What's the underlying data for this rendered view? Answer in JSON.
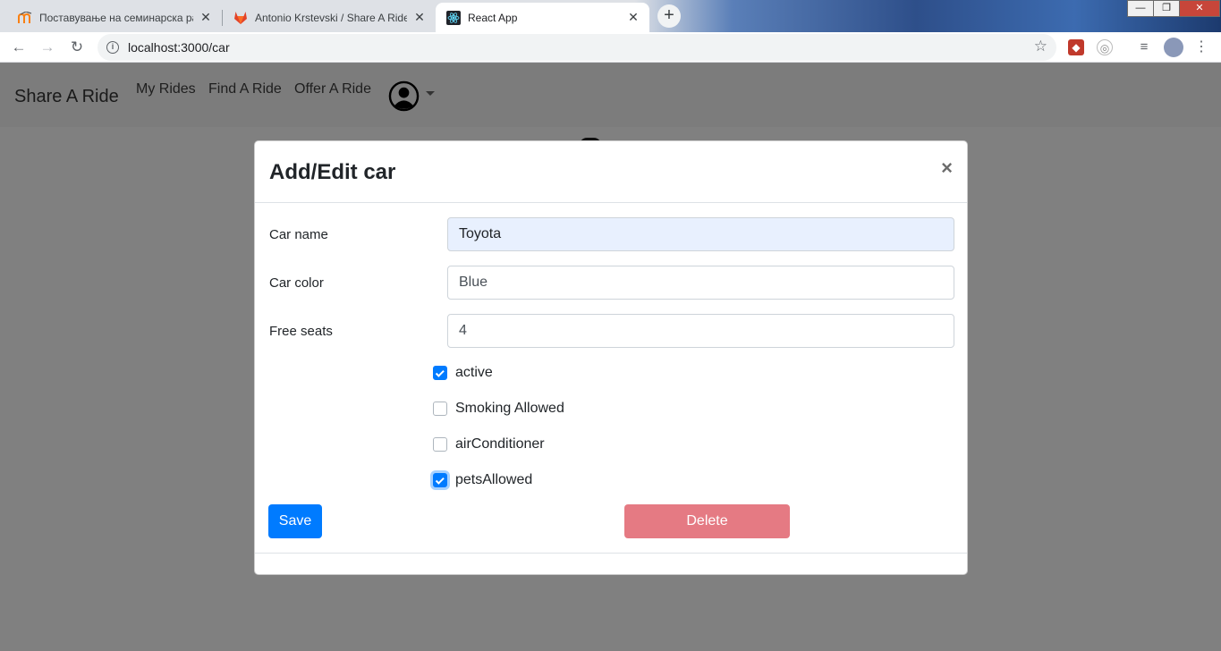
{
  "browser": {
    "tabs": [
      {
        "title": "Поставување на семинарска ра",
        "active": false,
        "icon": "moodle-icon"
      },
      {
        "title": "Antonio Krstevski / Share A Ride",
        "active": false,
        "icon": "gitlab-icon"
      },
      {
        "title": "React App",
        "active": true,
        "icon": "react-icon"
      }
    ],
    "new_tab_symbol": "+",
    "close_symbol": "✕",
    "url": "localhost:3000/car",
    "window_controls": {
      "minimize": "—",
      "maximize": "❐",
      "close": "✕"
    }
  },
  "app": {
    "brand": "Share A Ride",
    "nav_links": [
      "My Rides",
      "Find A Ride",
      "Offer A Ride"
    ]
  },
  "modal": {
    "title": "Add/Edit car",
    "close_symbol": "×",
    "fields": {
      "car_name": {
        "label": "Car name",
        "value": "Toyota"
      },
      "car_color": {
        "label": "Car color",
        "value": "Blue"
      },
      "free_seats": {
        "label": "Free seats",
        "value": "4"
      }
    },
    "checkboxes": [
      {
        "label": "active",
        "checked": true
      },
      {
        "label": "Smoking Allowed",
        "checked": false
      },
      {
        "label": "airConditioner",
        "checked": false
      },
      {
        "label": "petsAllowed",
        "checked": true
      }
    ],
    "save_label": "Save",
    "delete_label": "Delete"
  },
  "colors": {
    "primary": "#007bff",
    "danger_disabled": "#e57a83",
    "backdrop": "#808080",
    "autofill": "#e8f0fe"
  }
}
